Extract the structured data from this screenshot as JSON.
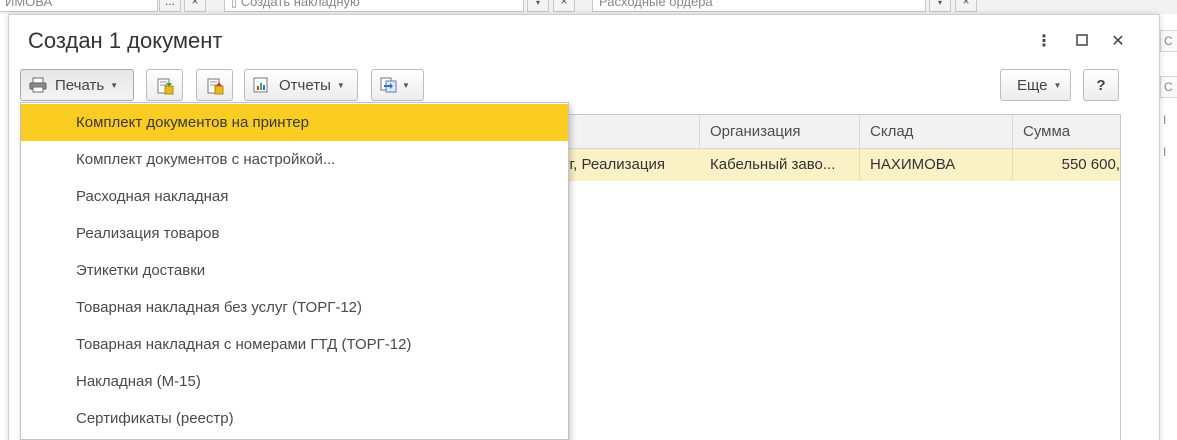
{
  "background": {
    "field1_text": "ИМОВА",
    "field1_btn": "...",
    "field1_close": "×",
    "field2_text": "Создать накладную",
    "field2_close": "×",
    "field3_text": "Расходные ордера",
    "field3_close": "×",
    "right_cut_1": "С",
    "right_cut_2": "I",
    "right_cut_3": "I"
  },
  "dialog": {
    "title": "Создан 1 документ",
    "more_icon": "⋮",
    "maximize_icon": "☐",
    "close_icon": "✕"
  },
  "toolbar": {
    "print_label": "Печать",
    "reports_label": "Отчеты",
    "more_label": "Еще",
    "help_label": "?"
  },
  "table": {
    "columns": [
      "Организация",
      "Склад",
      "Сумма"
    ],
    "row": {
      "document": "уг, Реализация",
      "organization": "Кабельный заво...",
      "warehouse": "НАХИМОВА",
      "sum": "550 600,"
    }
  },
  "print_menu": {
    "items": [
      "Комплект документов на принтер",
      "Комплект документов с настройкой...",
      "Расходная накладная",
      "Реализация товаров",
      "Этикетки доставки",
      "Товарная накладная без услуг (ТОРГ-12)",
      "Товарная накладная с номерами ГТД (ТОРГ-12)",
      "Накладная (М-15)",
      "Сертификаты (реестр)"
    ],
    "active_index": 0
  },
  "colors": {
    "menu_highlight": "#fbcc22",
    "row_highlight": "#fbf1c6"
  }
}
